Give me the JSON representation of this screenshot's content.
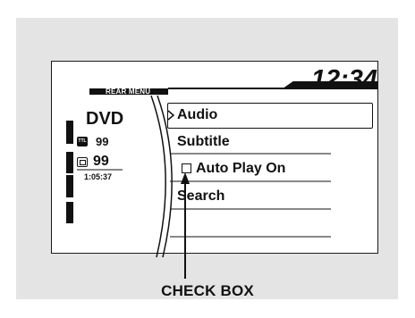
{
  "screen": {
    "clock": "12:34",
    "rear_menu_title": "REAR MENU",
    "source": "DVD",
    "title_badge": "TTL",
    "title_number": "99",
    "chapter_number": "99",
    "elapsed_time": "1:05:37"
  },
  "menu": {
    "items": [
      {
        "label": "Audio",
        "selected": true
      },
      {
        "label": "Subtitle",
        "selected": false
      },
      {
        "label": "Auto Play On",
        "selected": false,
        "checkbox": true,
        "checked": false
      },
      {
        "label": "Search",
        "selected": false
      }
    ]
  },
  "callout": {
    "label": "CHECK BOX"
  },
  "colors": {
    "panel_background": "#e4e4e4",
    "screen_background": "#ffffff",
    "ink": "#111111"
  }
}
